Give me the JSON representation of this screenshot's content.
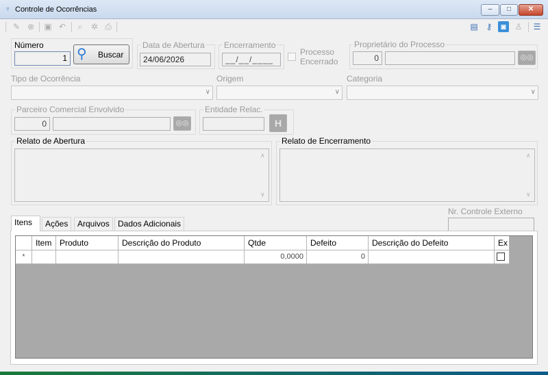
{
  "window": {
    "title": "Controle de Ocorrências",
    "min_glyph": "–",
    "max_glyph": "□",
    "close_glyph": "✕"
  },
  "form": {
    "numero_label": "Número",
    "numero_value": "1",
    "buscar_label": "Buscar",
    "data_abertura_label": "Data de Abertura",
    "data_abertura_value": "24/06/2026",
    "encerramento_label": "Encerramento",
    "encerramento_value": "__/__/____",
    "processo_encerrado_label_1": "Processo",
    "processo_encerrado_label_2": "Encerrado",
    "proprietario_label": "Proprietário do Processo",
    "proprietario_value": "0",
    "tipo_label": "Tipo de Ocorrência",
    "origem_label": "Origem",
    "categoria_label": "Categoria",
    "parceiro_label": "Parceiro Comercial Envolvido",
    "parceiro_value": "0",
    "entidade_label": "Entidade Relac.",
    "relato_abertura_label": "Relato de Abertura",
    "relato_encerramento_label": "Relato de Encerramento",
    "nr_controle_label": "Nr. Controle Externo"
  },
  "tabs": [
    {
      "label": "Itens"
    },
    {
      "label": "Ações"
    },
    {
      "label": "Arquivos"
    },
    {
      "label": "Dados Adicionais"
    }
  ],
  "grid": {
    "columns": [
      "Item",
      "Produto",
      "Descrição do Produto",
      "Qtde",
      "Defeito",
      "Descrição do Defeito",
      "Ex"
    ],
    "new_row": {
      "marker": "*",
      "item": "",
      "produto": "",
      "descricao": "",
      "qtde": "0,0000",
      "defeito": "0",
      "descricao_defeito": ""
    }
  }
}
